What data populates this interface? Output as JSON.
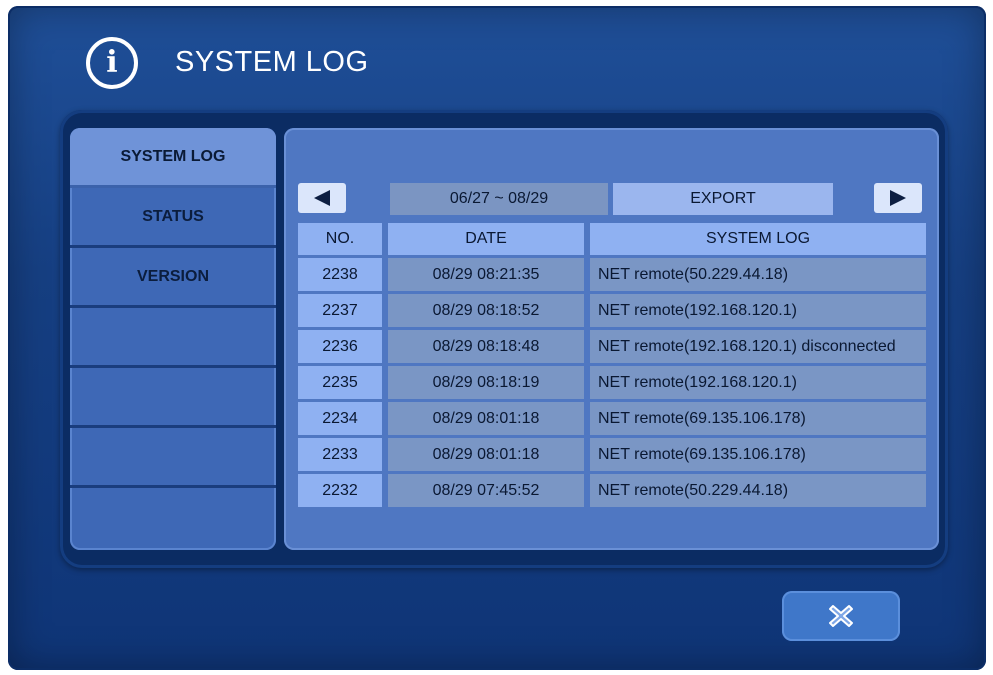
{
  "header": {
    "title": "SYSTEM LOG",
    "icon": "info-icon"
  },
  "sidebar": {
    "items": [
      {
        "label": "SYSTEM LOG",
        "active": true
      },
      {
        "label": "STATUS",
        "active": false
      },
      {
        "label": "VERSION",
        "active": false
      },
      {
        "label": "",
        "active": false
      },
      {
        "label": "",
        "active": false
      },
      {
        "label": "",
        "active": false
      }
    ]
  },
  "toolbar": {
    "prev_icon": "triangle-left-icon",
    "next_icon": "triangle-right-icon",
    "date_range": "06/27 ~ 08/29",
    "export_label": "EXPORT"
  },
  "table": {
    "columns": [
      "NO.",
      "DATE",
      "SYSTEM LOG"
    ],
    "rows": [
      {
        "no": "2238",
        "date": "08/29 08:21:35",
        "log": "NET remote(50.229.44.18)"
      },
      {
        "no": "2237",
        "date": "08/29 08:18:52",
        "log": "NET remote(192.168.120.1)"
      },
      {
        "no": "2236",
        "date": "08/29 08:18:48",
        "log": "NET remote(192.168.120.1) disconnected"
      },
      {
        "no": "2235",
        "date": "08/29 08:18:19",
        "log": "NET remote(192.168.120.1)"
      },
      {
        "no": "2234",
        "date": "08/29 08:01:18",
        "log": "NET remote(69.135.106.178)"
      },
      {
        "no": "2233",
        "date": "08/29 08:01:18",
        "log": "NET remote(69.135.106.178)"
      },
      {
        "no": "2232",
        "date": "08/29 07:45:52",
        "log": "NET remote(50.229.44.18)"
      }
    ]
  },
  "close_button": {
    "icon": "close-x-icon"
  },
  "colors": {
    "background": "#163f82",
    "panel": "#4f77c2",
    "header_cell": "#8fb1f2",
    "data_cell": "#7a96c5",
    "text": "#0a1832"
  }
}
